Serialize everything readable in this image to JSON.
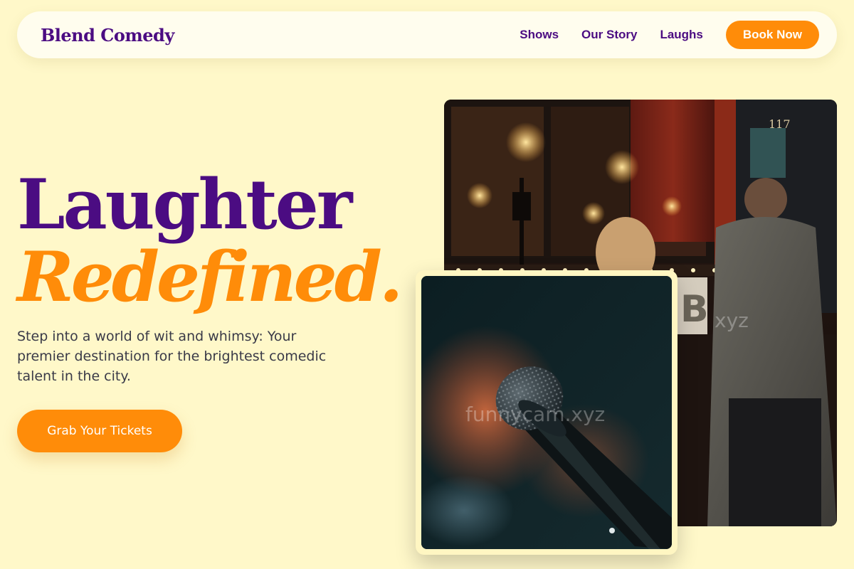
{
  "nav": {
    "brand": "Blend Comedy",
    "links": [
      "Shows",
      "Our Story",
      "Laughs"
    ],
    "cta": "Book Now"
  },
  "hero": {
    "title_line1": "Laughter",
    "title_line2": "Redefined.",
    "subtitle": "Step into a world of wit and whimsy: Your premier destination for the brightest comedic talent in the city.",
    "cta": "Grab Your Tickets"
  },
  "images": {
    "club_watermark": "xyz",
    "mic_watermark": "funnycam.xyz",
    "club_sign": "117",
    "club_letter": "B"
  },
  "colors": {
    "background": "#fff8c9",
    "purple": "#4b0c82",
    "orange": "#ff8c09"
  }
}
